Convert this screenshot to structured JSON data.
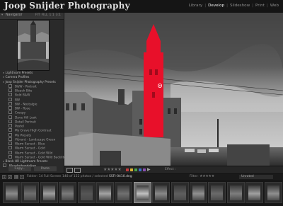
{
  "app": {
    "brand": "Joop Snijder Photography",
    "modules": [
      "Library",
      "Develop",
      "Slideshow",
      "Print",
      "Web"
    ],
    "active_module": "Develop"
  },
  "navigator": {
    "label": "Navigator",
    "zoom_options": [
      "FIT",
      "FILL",
      "1:1",
      "3:1"
    ]
  },
  "presets": {
    "items": [
      {
        "label": "Lightroom Presets"
      },
      {
        "label": "Camera Profiles"
      },
      {
        "label": "Joop Snijder Photography Presets"
      },
      {
        "label": "B&W - Portrait"
      },
      {
        "label": "Bleach Bite"
      },
      {
        "label": "Bold B&W"
      },
      {
        "label": "BW"
      },
      {
        "label": "BW - Nostalgie"
      },
      {
        "label": "BW - Rose"
      },
      {
        "label": "Creepy"
      },
      {
        "label": "Dave Hill Look"
      },
      {
        "label": "Detail Portrait"
      },
      {
        "label": "Pastel"
      },
      {
        "label": "My Grave High Contrast"
      },
      {
        "label": "My Presets"
      },
      {
        "label": "Vibrant - Landscape Green"
      },
      {
        "label": "Warm Sunset - Blue"
      },
      {
        "label": "Warm Sunset - Gold"
      },
      {
        "label": "Warm Sunset - Gold Wild"
      },
      {
        "label": "Warm Sunset - Gold Wild Backlite"
      },
      {
        "label": "Blank HR Lightroom Presets"
      },
      {
        "label": "Kleurbehandeling"
      }
    ],
    "copy_label": "Copy...",
    "paste_label": "Paste"
  },
  "toolbar": {
    "stars": "★★★★★",
    "color_labels": [
      "#c23a3a",
      "#d7b034",
      "#48a348",
      "#3f6fc8",
      "#8a4fb0"
    ],
    "label": "Effect :"
  },
  "filmstrip": {
    "source": "Folder: 14  Full Screen",
    "count": "148 of 152 photos",
    "selected_prefix": "/ selected",
    "filename": "SSFI-0410.dng",
    "filter_label": "Filter:",
    "filter_stars": "★★★★★",
    "dropdown": "Unrated",
    "thumb_count": 15,
    "selected_index": 7
  },
  "colors": {
    "accent_overlay": "#e8102a",
    "panel_bg": "#2a2a2a",
    "topbar_bg": "#151515"
  },
  "icons": [
    "grid-view-icon",
    "loupe-view-icon",
    "play-icon",
    "brush-pin-icon",
    "triangle-icon"
  ]
}
